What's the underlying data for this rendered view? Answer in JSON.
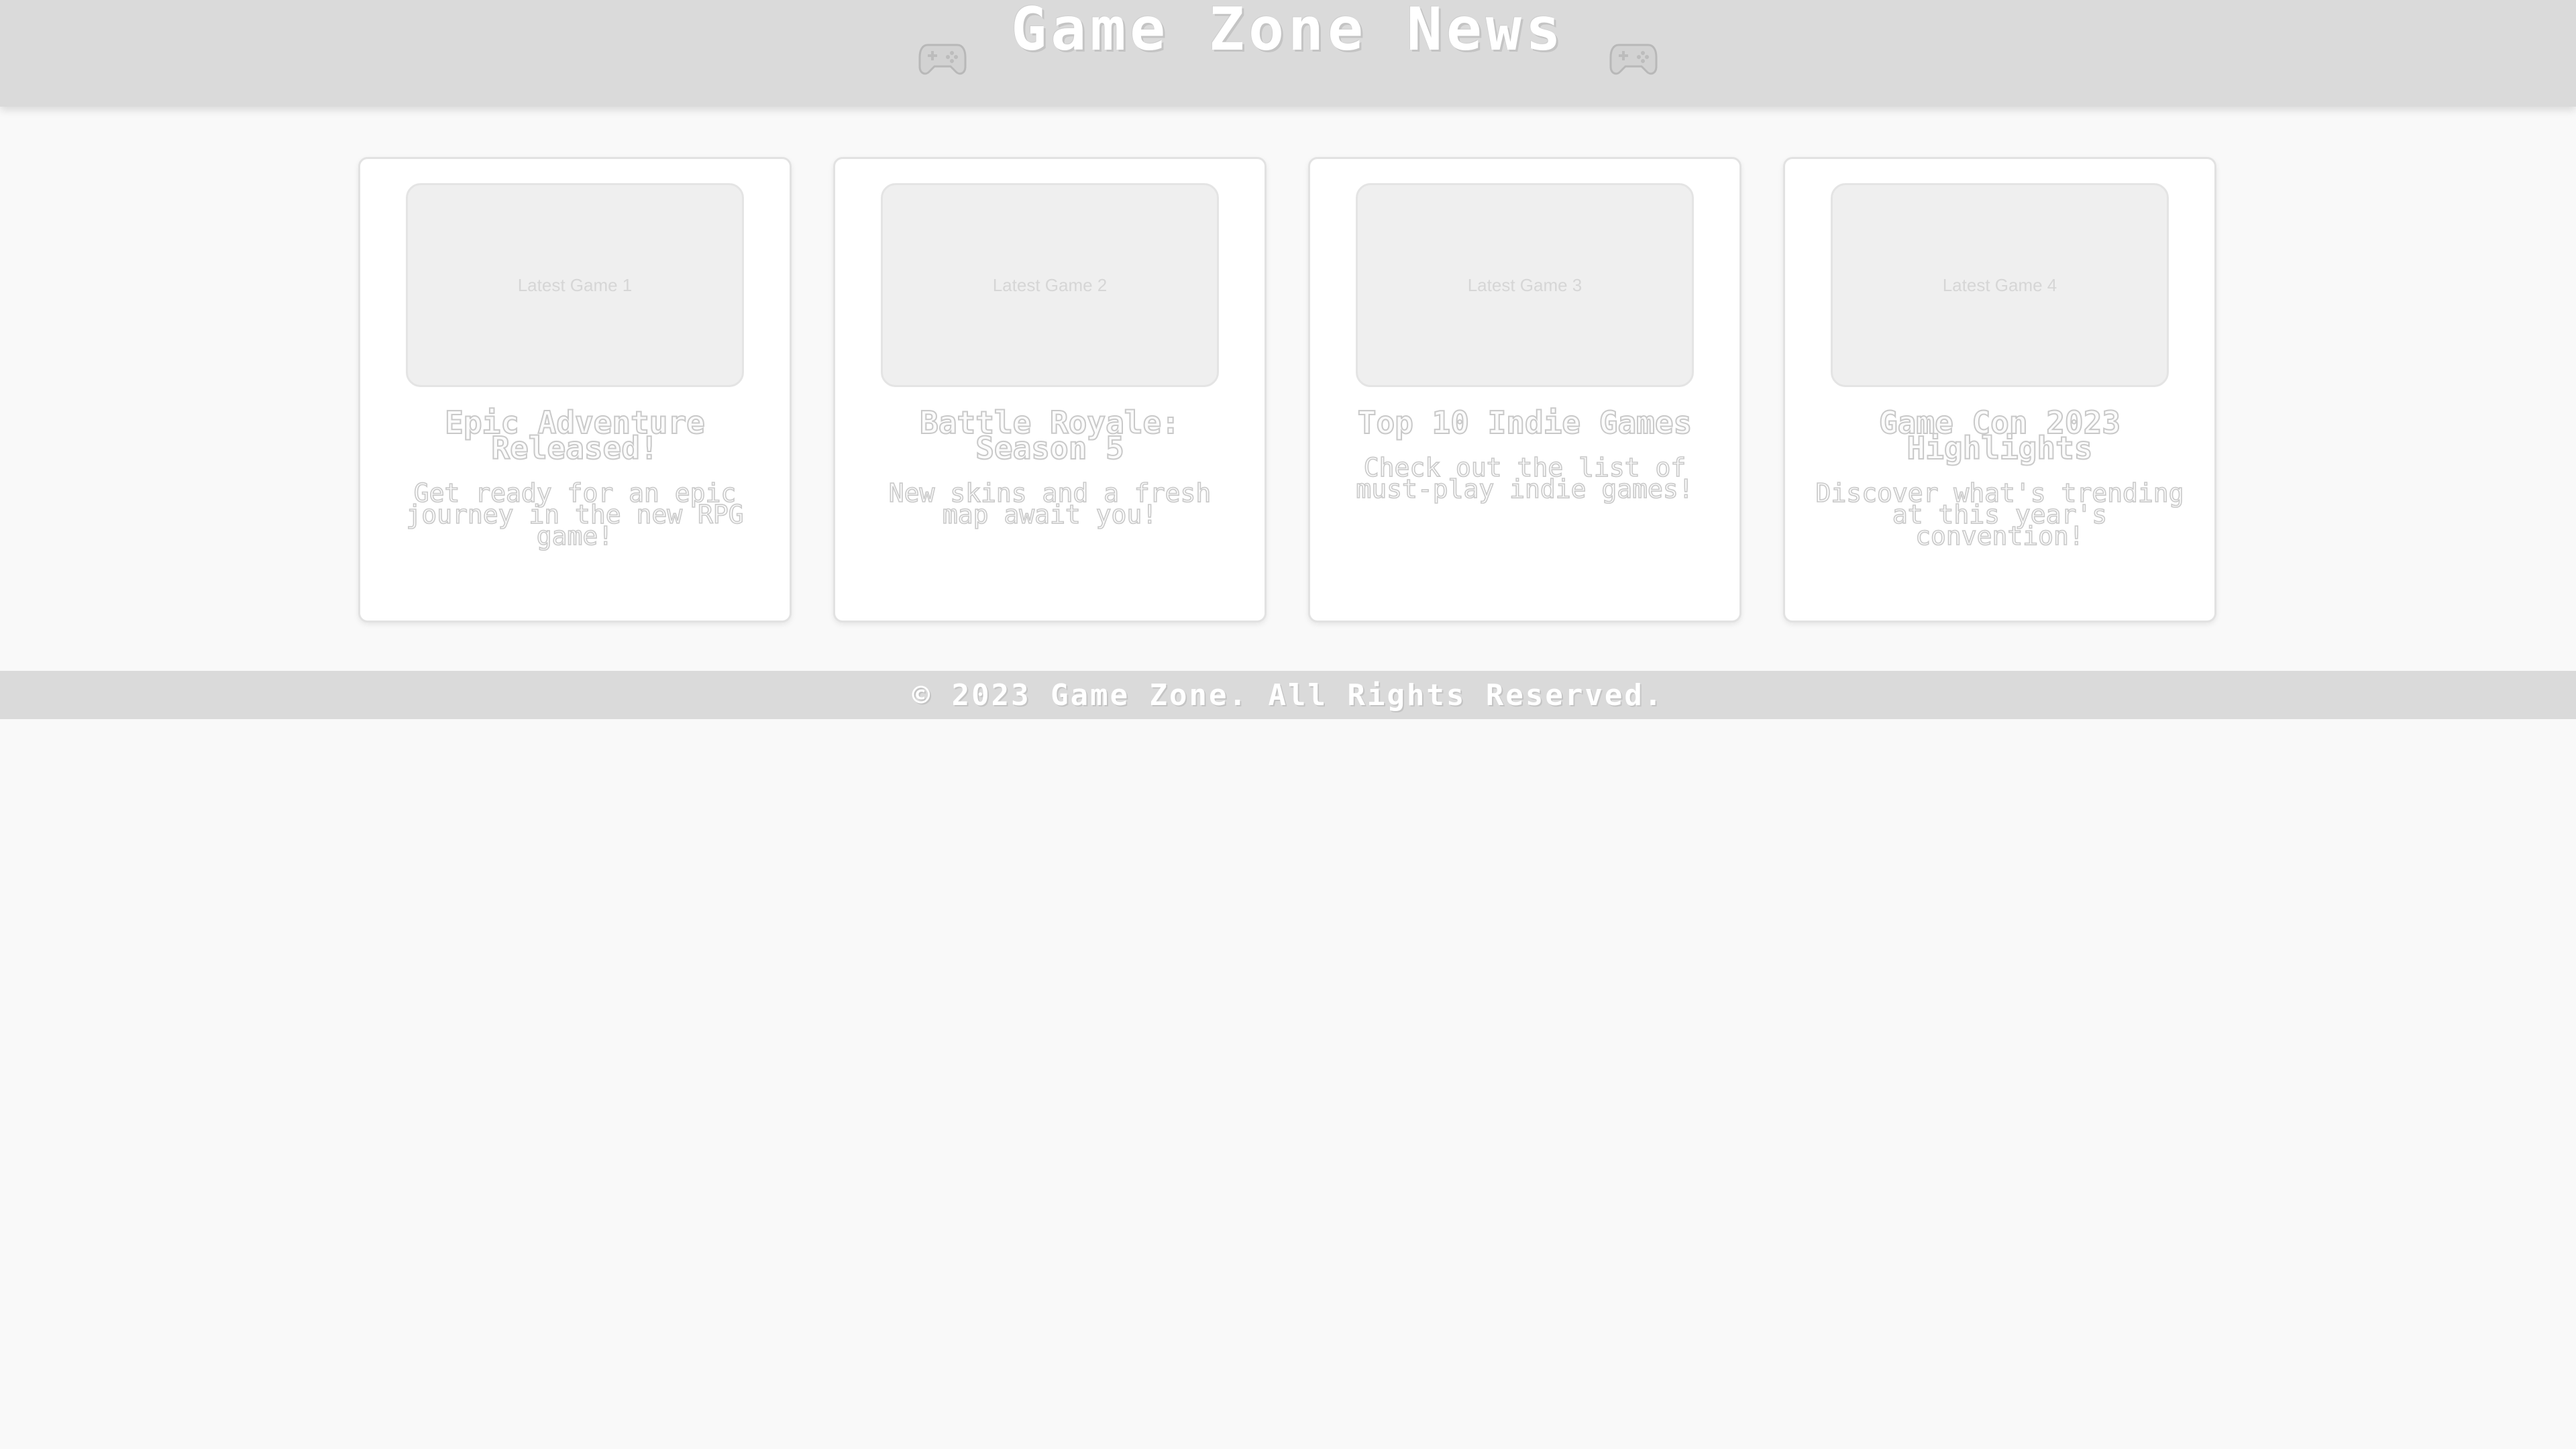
{
  "header": {
    "title": "Game Zone News",
    "left_icon": "game-controller-icon",
    "right_icon": "game-controller-icon"
  },
  "cards": [
    {
      "image_label": "Latest Game 1",
      "title": "Epic Adventure Released!",
      "description": "Get ready for an epic journey in the new RPG game!"
    },
    {
      "image_label": "Latest Game 2",
      "title": "Battle Royale: Season 5",
      "description": "New skins and a fresh map await you!"
    },
    {
      "image_label": "Latest Game 3",
      "title": "Top 10 Indie Games",
      "description": "Check out the list of must-play indie games!"
    },
    {
      "image_label": "Latest Game 4",
      "title": "Game Con 2023 Highlights",
      "description": "Discover what's trending at this year's convention!"
    }
  ],
  "footer": {
    "text": "© 2023 Game Zone. All Rights Reserved."
  },
  "colors": {
    "header_bg": "#dadada",
    "page_bg": "#f9f9f9",
    "card_bg": "#ffffff",
    "image_bg": "#efefef"
  }
}
